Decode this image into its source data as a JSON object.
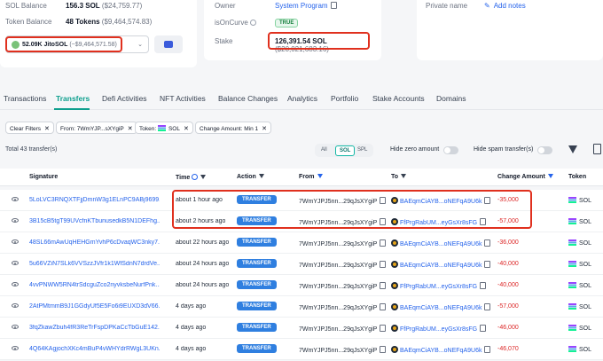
{
  "overview": {
    "sol_balance_label": "SOL Balance",
    "sol_balance_value": "156.3 SOL",
    "sol_balance_usd": "($24,759.77)",
    "token_balance_label": "Token Balance",
    "token_balance_value": "48 Tokens",
    "token_balance_usd": "($9,464,574.83)",
    "token_select_value": "52.09K JitoSOL",
    "token_select_usd": "(~$9,464,571.58)"
  },
  "account": {
    "owner_label": "Owner",
    "owner_value": "System Program",
    "oncurve_label": "isOnCurve",
    "oncurve_value": "TRUE",
    "stake_label": "Stake",
    "stake_value": "126,391.54 SOL",
    "stake_usd": "($20,021,683.16)"
  },
  "private": {
    "label": "Private name",
    "add_notes": "Add notes"
  },
  "tabs": [
    "Transactions",
    "Transfers",
    "Defi Activities",
    "NFT Activities",
    "Balance Changes",
    "Analytics",
    "Portfolio",
    "Stake Accounts",
    "Domains"
  ],
  "filters": {
    "clear": "Clear Filters",
    "from": "From: 7WmYJP...sXYgiP",
    "token_prefix": "Token:",
    "token_value": "SOL",
    "amount": "Change Amount: Min 1"
  },
  "summary": {
    "total": "Total 43 transfer(s)",
    "seg_all": "All",
    "seg_sol": "SOL",
    "seg_spl": "SPL",
    "hide_zero": "Hide zero amount",
    "hide_spam": "Hide spam transfer(s)"
  },
  "columns": {
    "signature": "Signature",
    "time": "Time",
    "action": "Action",
    "from": "From",
    "to": "To",
    "amount": "Change Amount",
    "token": "Token"
  },
  "rows": [
    {
      "sig": "5LoLVC3RNQXTFjjDmnW3g1ELnPC9ABj9699...",
      "time": "about 1 hour ago",
      "action": "TRANSFER",
      "from": "7WmYJPJ5nn...29qJsXYgiP",
      "to": "BAEqmCiAYB...oNEFqA9U6k",
      "amount": "-35,000",
      "token": "SOL"
    },
    {
      "sig": "3B15cB5tgT99UVcfnKTbunusedkB5N1DEFhg...",
      "time": "about 2 hours ago",
      "action": "TRANSFER",
      "from": "7WmYJPJ5nn...29qJsXYgiP",
      "to": "FfPrgRabUM...eyGsXr8sFG",
      "amount": "-57,000",
      "token": "SOL"
    },
    {
      "sig": "48SL66mAwUqHEHGmYvhP6cDvaqWC3nky7...",
      "time": "about 22 hours ago",
      "action": "TRANSFER",
      "from": "7WmYJPJ5nn...29qJsXYgiP",
      "to": "BAEqmCiAYB...oNEFqA9U6k",
      "amount": "-36,000",
      "token": "SOL"
    },
    {
      "sig": "5u66VZiN7SLk6VVSzzJVfr1k1WfSdnN7drdVe...",
      "time": "about 24 hours ago",
      "action": "TRANSFER",
      "from": "7WmYJPJ5nn...29qJsXYgiP",
      "to": "BAEqmCiAYB...oNEFqA9U6k",
      "amount": "-40,000",
      "token": "SOL"
    },
    {
      "sig": "4vvPNWW5RN4trSdcguZco2nyvksbeNurfPnk...",
      "time": "about 24 hours ago",
      "action": "TRANSFER",
      "from": "7WmYJPJ5nn...29qJsXYgiP",
      "to": "FfPrgRabUM...eyGsXr8sFG",
      "amount": "-40,000",
      "token": "SOL"
    },
    {
      "sig": "2AtPMtmmB9J1GGdyUf5E5Fo6i9EUXD3dV66...",
      "time": "4 days ago",
      "action": "TRANSFER",
      "from": "7WmYJPJ5nn...29qJsXYgiP",
      "to": "BAEqmCiAYB...oNEFqA9U6k",
      "amount": "-57,000",
      "token": "SOL"
    },
    {
      "sig": "3fqZkawZbuh4fR3ReTrFspDPKaCcTbGuE142...",
      "time": "4 days ago",
      "action": "TRANSFER",
      "from": "7WmYJPJ5nn...29qJsXYgiP",
      "to": "FfPrgRabUM...eyGsXr8sFG",
      "amount": "-46,000",
      "token": "SOL"
    },
    {
      "sig": "4Q64KAgjochXKc4mBuP4vWHYdrRWgL3UKn...",
      "time": "4 days ago",
      "action": "TRANSFER",
      "from": "7WmYJPJ5nn...29qJsXYgiP",
      "to": "BAEqmCiAYB...oNEFqA9U6k",
      "amount": "-46,070",
      "token": "SOL"
    }
  ],
  "colors": {
    "accent": "#0e9f8e",
    "link": "#2563eb",
    "negative": "#dc2626",
    "highlight": "#e0301e"
  }
}
